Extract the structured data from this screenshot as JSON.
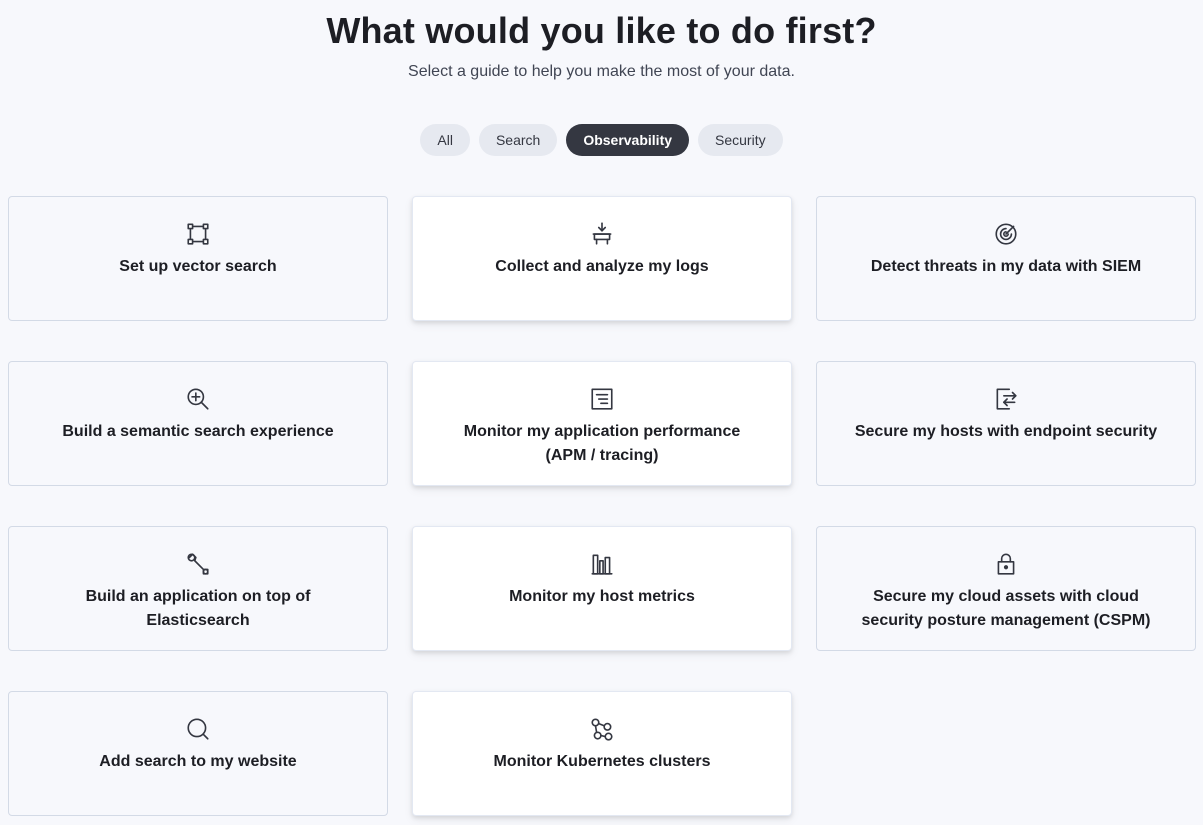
{
  "header": {
    "title": "What would you like to do first?",
    "subtitle": "Select a guide to help you make the most of your data."
  },
  "filters": [
    {
      "label": "All",
      "active": false
    },
    {
      "label": "Search",
      "active": false
    },
    {
      "label": "Observability",
      "active": true
    },
    {
      "label": "Security",
      "active": false
    }
  ],
  "cards": {
    "search": [
      {
        "label": "Set up vector search",
        "icon": "vector-icon"
      },
      {
        "label": "Build a semantic search experience",
        "icon": "magnify-plus-icon"
      },
      {
        "label": "Build an application on top of Elasticsearch",
        "icon": "wrench-icon"
      },
      {
        "label": "Add search to my website",
        "icon": "search-icon"
      }
    ],
    "observability": [
      {
        "label": "Collect and analyze my logs",
        "icon": "logs-ingest-icon"
      },
      {
        "label": "Monitor my application performance (APM / tracing)",
        "icon": "document-lines-icon"
      },
      {
        "label": "Monitor my host metrics",
        "icon": "metrics-bars-icon"
      },
      {
        "label": "Monitor Kubernetes clusters",
        "icon": "cluster-nodes-icon"
      }
    ],
    "security": [
      {
        "label": "Detect threats in my data with SIEM",
        "icon": "radar-icon"
      },
      {
        "label": "Secure my hosts with endpoint security",
        "icon": "endpoint-arrows-icon"
      },
      {
        "label": "Secure my cloud assets with cloud security posture management (CSPM)",
        "icon": "lock-icon"
      }
    ]
  }
}
